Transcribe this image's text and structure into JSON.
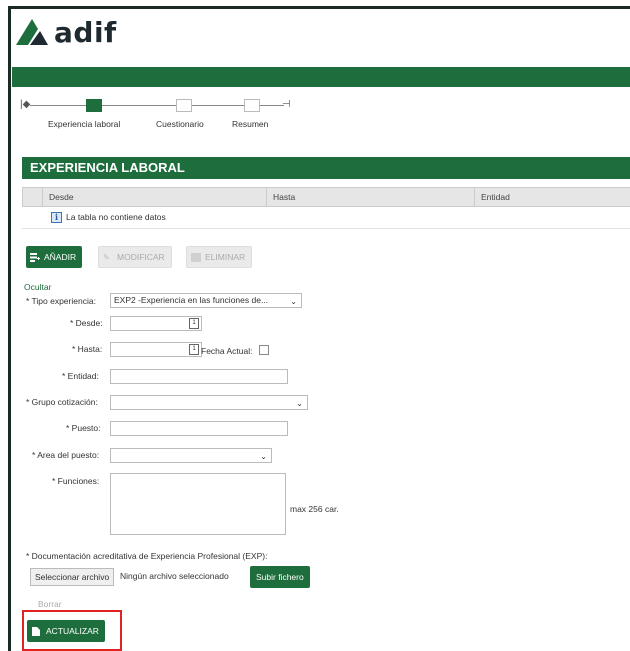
{
  "brand": {
    "name": "adif",
    "color": "#1e6e3d",
    "highlight_color": "#e02424"
  },
  "stepper": {
    "steps": [
      {
        "label": "Experiencia laboral",
        "state": "active"
      },
      {
        "label": "Cuestionario",
        "state": "pending"
      },
      {
        "label": "Resumen",
        "state": "pending"
      }
    ]
  },
  "section": {
    "title": "EXPERIENCIA LABORAL"
  },
  "table": {
    "columns": [
      "Desde",
      "Hasta",
      "Entidad"
    ],
    "empty_message": "La tabla no contiene datos"
  },
  "actions": {
    "add": "AÑADIR",
    "modify": "MODIFICAR",
    "delete": "ELIMINAR"
  },
  "form": {
    "toggle_label": "Ocultar",
    "tipo_experiencia": {
      "label": "* Tipo experiencia:",
      "value": "EXP2 -Experiencia en las funciones de..."
    },
    "desde": {
      "label": "* Desde:",
      "value": ""
    },
    "hasta": {
      "label": "* Hasta:",
      "value": "",
      "fecha_actual_label": "Fecha Actual:"
    },
    "entidad": {
      "label": "* Entidad:",
      "value": ""
    },
    "grupo_cotizacion": {
      "label": "* Grupo cotización:",
      "value": ""
    },
    "puesto": {
      "label": "* Puesto:",
      "value": ""
    },
    "area_puesto": {
      "label": "* Area del puesto:",
      "value": ""
    },
    "funciones": {
      "label": "* Funciones:",
      "value": "",
      "hint": "max 256 car."
    },
    "documentacion": {
      "label": "* Documentación acreditativa de Experiencia Profesional (EXP):",
      "file_button": "Seleccionar archivo",
      "file_status": "Ningún archivo seleccionado",
      "upload_button": "Subir fichero"
    },
    "clear_label": "Borrar",
    "update_button": "ACTUALIZAR"
  }
}
